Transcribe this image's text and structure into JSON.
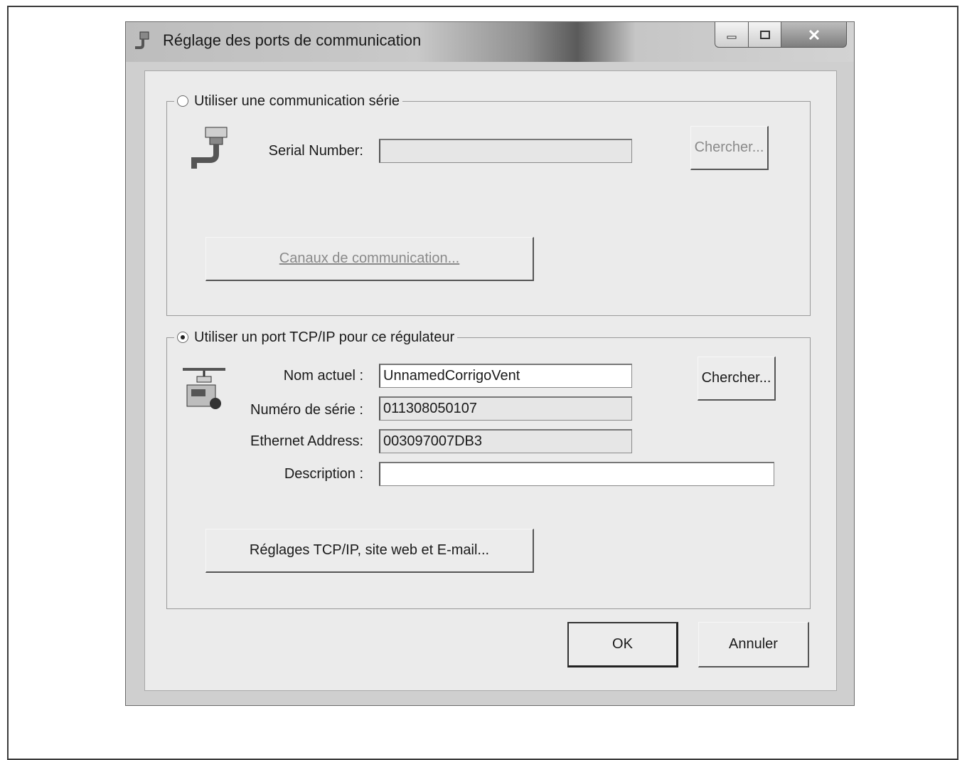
{
  "window": {
    "title": "Réglage des ports de communication"
  },
  "serial_group": {
    "legend": "Utiliser une communication série",
    "selected": false,
    "serial_number_label": "Serial Number:",
    "serial_number_value": "",
    "search_button": "Chercher...",
    "channels_button": "Canaux de communication..."
  },
  "tcp_group": {
    "legend": "Utiliser un port TCP/IP pour ce régulateur",
    "selected": true,
    "current_name_label": "Nom actuel :",
    "current_name_value": "UnnamedCorrigoVent",
    "serial_no_label": "Numéro de série :",
    "serial_no_value": "011308050107",
    "ethernet_label": "Ethernet Address:",
    "ethernet_value": "003097007DB3",
    "description_label": "Description :",
    "description_value": "",
    "search_button": "Chercher...",
    "settings_button": "Réglages TCP/IP, site web et E-mail..."
  },
  "footer": {
    "ok_label": "OK",
    "cancel_label": "Annuler"
  }
}
